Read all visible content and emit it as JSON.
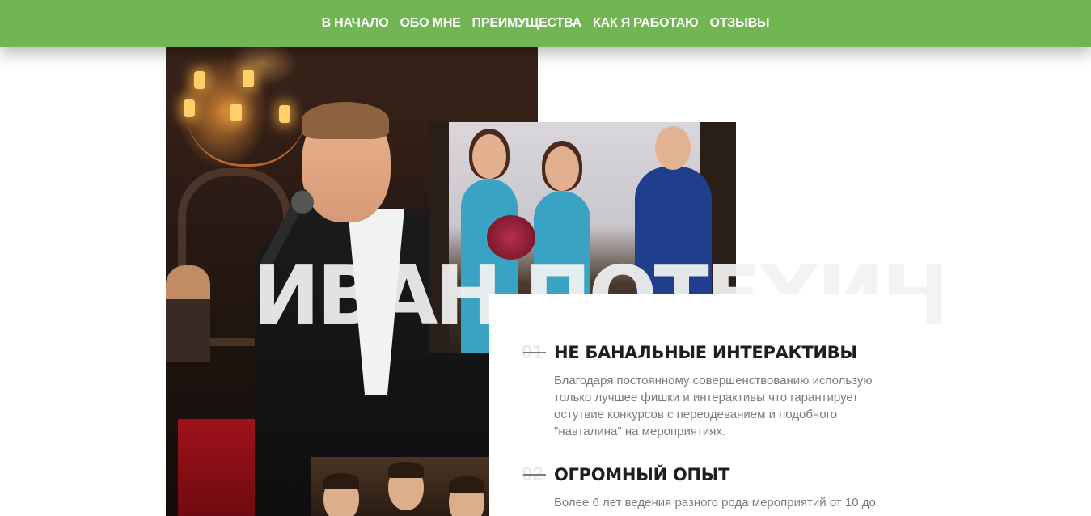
{
  "nav": {
    "items": [
      {
        "label": "В НАЧАЛО"
      },
      {
        "label": "ОБО МНЕ"
      },
      {
        "label": "ПРЕИМУЩЕСТВА"
      },
      {
        "label": "КАК Я РАБОТАЮ"
      },
      {
        "label": "ОТЗЫВЫ"
      }
    ]
  },
  "hero": {
    "name": "ИВАН ПОТЕХИН"
  },
  "features": [
    {
      "number": "01",
      "title": "НЕ БАНАЛЬНЫЕ ИНТЕРАКТИВЫ",
      "text": "Благодаря постоянному совершенствованию использую только лучшее фишки и интерактивы что гарантирует остутвие конкурсов с переодеванием и подобного \"навталина\" на мероприятиях."
    },
    {
      "number": "02",
      "title": "ОГРОМНЫЙ ОПЫТ",
      "text": "Более 6 лет ведения разного рода мероприятий от 10 до"
    }
  ],
  "colors": {
    "nav_bg": "#72b653",
    "title": "#1e1e1e",
    "body_text": "#7b7b7b"
  }
}
